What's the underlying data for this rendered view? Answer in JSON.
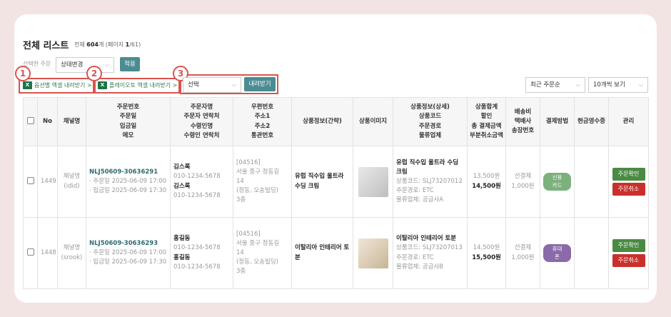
{
  "page": {
    "title": "전체 리스트",
    "count_prefix": "전체",
    "count_total": "604",
    "count_unit": "개 (페이지",
    "count_page": "1",
    "count_suffix": "/61)"
  },
  "toolbar": {
    "select_label": "선택한 주문",
    "status_select": "상태변경",
    "apply_label": "적용",
    "excel_option_label": "옵션별 엑셀 내려받기 >",
    "excel_playauto_label": "플레이오토 엑셀 내려받기 >",
    "download_select": "선택",
    "download_label": "내려받기",
    "sort_select": "최근 주문순",
    "view_select": "10개씩 보기",
    "annotations": [
      "1",
      "2",
      "3"
    ]
  },
  "table": {
    "headers": {
      "no": "No",
      "channel": "채널명",
      "order": [
        "주문번호",
        "주문일",
        "입금일",
        "메모"
      ],
      "customer": [
        "주문자명",
        "주문자 연락처",
        "수령인명",
        "수령인 연락처"
      ],
      "address": [
        "우편번호",
        "주소1",
        "주소2",
        "통관번호"
      ],
      "product_short": "상품정보(간략)",
      "image": "상품이미지",
      "product_detail": [
        "상품정보(상세)",
        "상품코드",
        "주문경로",
        "물류업체"
      ],
      "amount": [
        "상품합계",
        "할인",
        "총 결제금액",
        "부분취소금액"
      ],
      "shipping": [
        "배송비",
        "택배사",
        "송장번호"
      ],
      "payment": "결제방법",
      "receipt": "현금영수증",
      "manage": "관리"
    },
    "rows": [
      {
        "no": "1449",
        "channel": "채널명",
        "channel_id": "(idid)",
        "order_no": "NLJ50609-30636291",
        "order_date": "· 주문일 2025-06-09 17:00",
        "paid_date": "· 입금일 2025-06-09 17:30",
        "orderer": "김스록",
        "orderer_phone": "010-1234-5678",
        "receiver": "김스록",
        "receiver_phone": "010-1234-5678",
        "zip": "[04516]",
        "addr1": "서울 중구 정동길 14",
        "addr2": "(정동, 오송빌딩)",
        "addr3": "3층",
        "product_short": "유럽 직수입 울트라 수딩 크림",
        "product_detail": "유럽 직수입 울트라 수딩 크림",
        "product_code": "상품코드: SLJ73207012",
        "order_route": "주문경로: ETC",
        "logistics": "물류업체: 공급사A",
        "amount_total": "13,500원",
        "amount_pay": "14,500원",
        "shipping_type": "선결제",
        "shipping_fee": "1,000원",
        "payment": "신용카드",
        "payment_color": "#7cb07c",
        "confirm": "주문확인",
        "cancel": "주문취소"
      },
      {
        "no": "1448",
        "channel": "채널명",
        "channel_id": "(srook)",
        "order_no": "NLJ50609-30636293",
        "order_date": "· 주문일 2025-06-09 17:00",
        "paid_date": "· 입금일 2025-06-09 17:30",
        "orderer": "홍길동",
        "orderer_phone": "010-1234-5678",
        "receiver": "홍길동",
        "receiver_phone": "010-1234-5678",
        "zip": "[04516]",
        "addr1": "서울 중구 정동길 14",
        "addr2": "(정동, 오송빌딩)",
        "addr3": "3층",
        "product_short": "이탈리아 인테리어 토분",
        "product_detail": "이탈리아 인테리어 토분",
        "product_code": "상품코드: SLJ73207013",
        "order_route": "주문경로: ETC",
        "logistics": "물류업체: 공급사B",
        "amount_total": "14,500원",
        "amount_pay": "15,500원",
        "shipping_type": "선결제",
        "shipping_fee": "1,000원",
        "payment": "휴대폰",
        "payment_color": "#8a6aa8",
        "confirm": "주문확인",
        "cancel": "주문취소"
      }
    ]
  },
  "colors": {
    "accent_teal": "#4a8c92",
    "annotation_red": "#d9534f",
    "confirm_green": "#4b8a43",
    "cancel_red": "#c9302c"
  }
}
